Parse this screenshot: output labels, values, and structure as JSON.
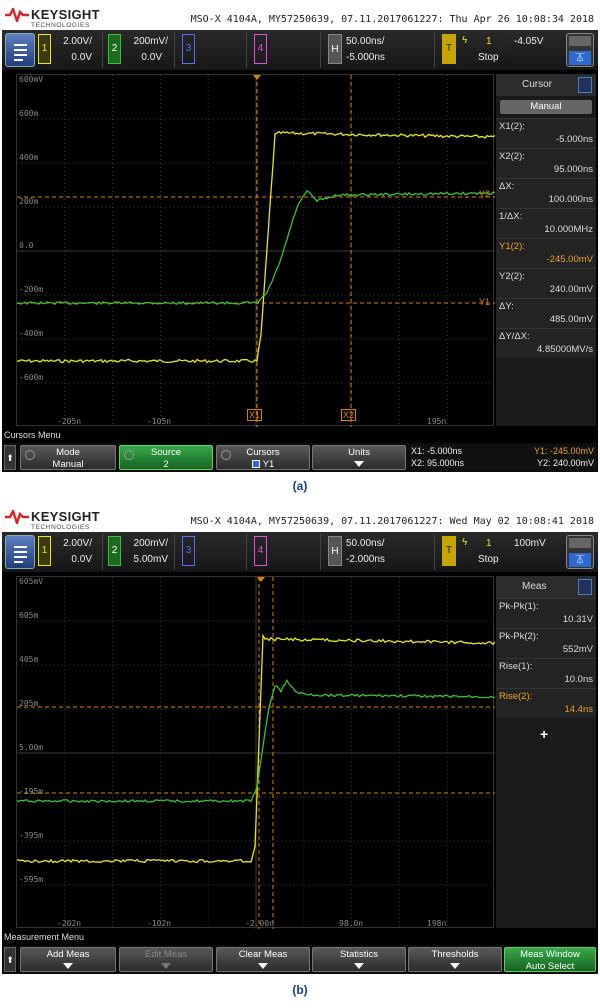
{
  "brand": {
    "name": "KEYSIGHT",
    "sub": "TECHNOLOGIES"
  },
  "colors": {
    "ch1": "#e8e820",
    "ch2": "#3cc03c",
    "ch3": "#5a6aff",
    "ch4": "#e050e0",
    "cursor": "#e08000",
    "active": "#2d6bd1"
  },
  "screens": [
    {
      "caption": "(a)",
      "header": "MSO-X 4104A, MY57250639, 07.11.2017061227: Thu Apr 26 10:08:34 2018",
      "ch1": {
        "num": "1",
        "scale": "2.00V/",
        "offset": "0.0V"
      },
      "ch2": {
        "num": "2",
        "scale": "200mV/",
        "offset": "0.0V"
      },
      "ch3": {
        "num": "3"
      },
      "ch4": {
        "num": "4"
      },
      "horiz": {
        "label": "H",
        "scale": "50.00ns/",
        "delay": "-5.000ns"
      },
      "trig": {
        "label": "T",
        "src": "1",
        "level": "-4.05V",
        "state": "Stop"
      },
      "acq_icon": "waveform-icon",
      "y_labels": [
        "600mV",
        "600m",
        "400m",
        "200m",
        "0.0",
        "-200m",
        "-400m",
        "-600m"
      ],
      "x_labels": [
        "-205n",
        "-105n",
        "195n"
      ],
      "markers": {
        "x1": "X1",
        "x2": "X2",
        "y1": "Y1",
        "y2": "Y2"
      },
      "side": {
        "title": "Cursor",
        "mode": "Manual",
        "rows": [
          {
            "label": "X1(2):",
            "value": "-5.000ns"
          },
          {
            "label": "X2(2):",
            "value": "95.000ns"
          },
          {
            "label": "ΔX:",
            "value": "100.000ns"
          },
          {
            "label": "1/ΔX:",
            "value": "10.000MHz"
          },
          {
            "label": "Y1(2):",
            "value": "-245.00mV"
          },
          {
            "label": "Y2(2):",
            "value": "240.00mV"
          },
          {
            "label": "ΔY:",
            "value": "485.00mV"
          },
          {
            "label": "ΔY/ΔX:",
            "value": "4.85000MV/s"
          }
        ]
      },
      "menu_label": "Cursors Menu",
      "softkeys": [
        {
          "a": "Mode",
          "b": "Manual"
        },
        {
          "a": "Source",
          "b": "2"
        },
        {
          "a": "Cursors",
          "b": "Y1"
        },
        {
          "a": "Units",
          "b": ""
        }
      ],
      "cursor_info": {
        "x1": "X1: -5.000ns",
        "x2": "X2: 95.000ns",
        "y1": "Y1: -245.00mV",
        "y2": "Y2: 240.00mV"
      }
    },
    {
      "caption": "(b)",
      "header": "MSO-X 4104A, MY57250639, 07.11.2017061227: Wed May 02 10:08:41 2018",
      "ch1": {
        "num": "1",
        "scale": "2.00V/",
        "offset": "0.0V"
      },
      "ch2": {
        "num": "2",
        "scale": "200mV/",
        "offset": "5.00mV"
      },
      "ch3": {
        "num": "3"
      },
      "ch4": {
        "num": "4"
      },
      "horiz": {
        "label": "H",
        "scale": "50.00ns/",
        "delay": "-2.000ns"
      },
      "trig": {
        "label": "T",
        "src": "1",
        "level": "100mV",
        "state": "Stop"
      },
      "acq_icon": "waveform-icon",
      "y_labels": [
        "605mV",
        "605m",
        "405m",
        "205m",
        "5.00m",
        "-195m",
        "-395m",
        "-595m"
      ],
      "x_labels": [
        "-202n",
        "-102n",
        "-2.00n",
        "98.0n",
        "198n"
      ],
      "side": {
        "title": "Meas",
        "rows": [
          {
            "label": "Pk-Pk(1):",
            "value": "10.31V"
          },
          {
            "label": "Pk-Pk(2):",
            "value": "552mV"
          },
          {
            "label": "Rise(1):",
            "value": "10.0ns"
          },
          {
            "label": "Rise(2):",
            "value": "14.4ns"
          }
        ],
        "add": "+"
      },
      "menu_label": "Measurement Menu",
      "softkeys": [
        {
          "a": "Add Meas",
          "b": ""
        },
        {
          "a": "Edit Meas",
          "b": ""
        },
        {
          "a": "Clear Meas",
          "b": ""
        },
        {
          "a": "Statistics",
          "b": ""
        },
        {
          "a": "Thresholds",
          "b": ""
        },
        {
          "a": "Meas Window",
          "b": "Auto Select"
        }
      ]
    }
  ]
}
